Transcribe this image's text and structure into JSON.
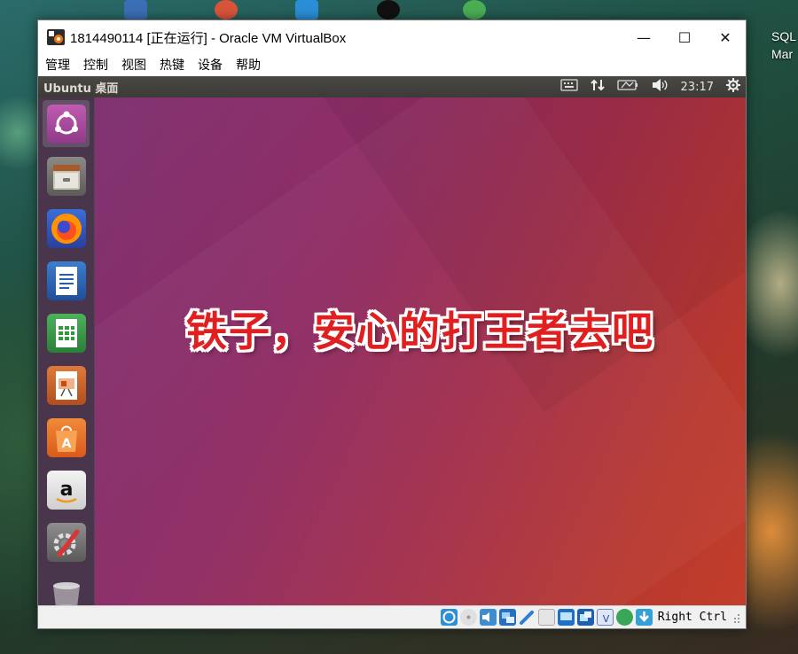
{
  "desktop": {
    "right_label_1": "SQL",
    "right_label_2": "Mar"
  },
  "window": {
    "title": "1814490114 [正在运行] - Oracle VM VirtualBox",
    "minimize": "—",
    "maximize": "☐",
    "close": "✕",
    "menu": [
      "管理",
      "控制",
      "视图",
      "热键",
      "设备",
      "帮助"
    ]
  },
  "ubuntu": {
    "panel_title": "Ubuntu 桌面",
    "clock": "23:17",
    "tray": [
      "keyboard-icon",
      "network-icon",
      "battery-icon",
      "volume-icon",
      "gear-icon"
    ],
    "launcher": [
      "ubuntu-dash-icon",
      "files-icon",
      "firefox-icon",
      "writer-icon",
      "calc-icon",
      "impress-icon",
      "software-center-icon",
      "amazon-icon",
      "system-settings-icon",
      "trash-icon"
    ],
    "caption": "铁子，安心的打王者去吧"
  },
  "statusbar": {
    "icons": [
      "hard-disk-icon",
      "optical-disk-icon",
      "audio-icon",
      "network-adapter-icon",
      "usb-icon",
      "shared-folder-icon",
      "display-icon",
      "video-capture-icon",
      "virtualization-icon",
      "mouse-integration-icon",
      "download-icon"
    ],
    "host_key": "Right Ctrl"
  },
  "colors": {
    "wallpaper_start": "#7a2a6b",
    "wallpaper_end": "#c23e2a",
    "caption_text": "#e02020",
    "caption_outline": "#ffffff"
  }
}
